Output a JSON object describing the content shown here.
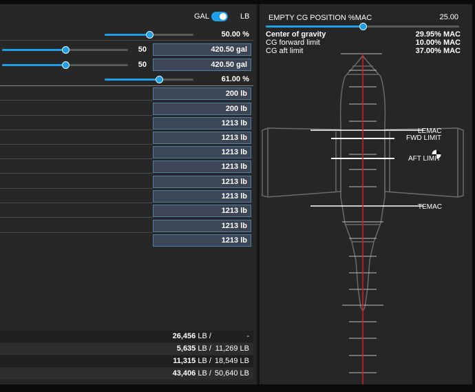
{
  "unit_toggle": {
    "left_label": "GAL",
    "right_label": "LB",
    "selected": "LB"
  },
  "sliders": [
    {
      "id": "fuel-total",
      "value_text": "50.00 %",
      "fraction": 0.5
    },
    {
      "id": "tank-left",
      "count": "50",
      "field": "420.50 gal",
      "fraction": 0.5
    },
    {
      "id": "tank-right",
      "count": "50",
      "field": "420.50 gal",
      "fraction": 0.5
    },
    {
      "id": "payload-total",
      "value_text": "61.00 %",
      "fraction": 0.61
    }
  ],
  "weight_fields": [
    "200 lb",
    "200 lb",
    "1213 lb",
    "1213 lb",
    "1213 lb",
    "1213 lb",
    "1213 lb",
    "1213 lb",
    "1213 lb",
    "1213 lb",
    "1213 lb"
  ],
  "summary_rows": [
    {
      "left": "26,456",
      "unit": "LB /",
      "right": "-"
    },
    {
      "left": "5,635",
      "unit": "LB /",
      "right": "11,269 LB"
    },
    {
      "left": "11,315",
      "unit": "LB /",
      "right": "18,549 LB"
    },
    {
      "left": "43,406",
      "unit": "LB /",
      "right": "50,640 LB"
    }
  ],
  "cg_panel": {
    "title": "EMPTY CG POSITION %MAC",
    "value": "25.00",
    "slider_fraction": 0.5,
    "rows": [
      {
        "label": "Center of gravity",
        "value": "29.95% MAC"
      },
      {
        "label": "CG forward limit",
        "value": "10.00% MAC"
      },
      {
        "label": "CG aft limit",
        "value": "37.00% MAC"
      }
    ],
    "markers": {
      "lemac": "LEMAC",
      "fwd": "FWD LIMIT",
      "aft": "AFT LIMIT",
      "temac": "TEMAC"
    }
  },
  "colors": {
    "accent": "#1e9fe6",
    "centerline": "#d42020",
    "field_bg": "#3d4656"
  }
}
